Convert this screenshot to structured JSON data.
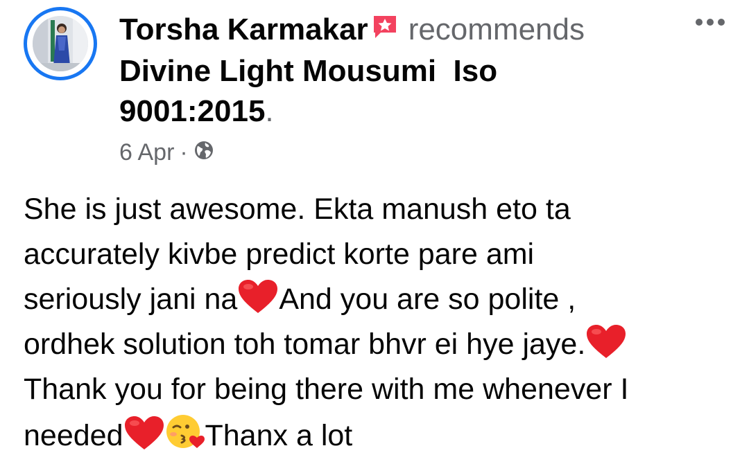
{
  "post": {
    "author_name": "Torsha Karmakar",
    "action_text": "recommends",
    "page_name_line1": "Divine Light Mousumi  Iso",
    "page_name_line2": "9001:2015",
    "page_name_suffix": ".",
    "date": "6 Apr",
    "separator": "·",
    "privacy_icon": "globe-icon",
    "recommend_icon": "recommend-badge-icon",
    "more_icon": "more-options-icon",
    "body": {
      "l1": "She is just awesome. Ekta manush eto ta",
      "l2": "accurately kivbe predict korte pare ami",
      "l3a": "seriously jani na",
      "l3b": "And you are so polite ,",
      "l4": "ordhek solution toh tomar bhvr ei hye jaye.",
      "l5": "Thank you for being there with me whenever I",
      "l6a": "needed",
      "l6b": "Thanx a lot"
    },
    "emoji": [
      "red-heart",
      "face-blowing-a-kiss"
    ]
  },
  "colors": {
    "accent": "#1877f2",
    "text": "#050505",
    "secondary_text": "#65676b",
    "heart": "#e8202a",
    "badge": "#f3425f"
  }
}
